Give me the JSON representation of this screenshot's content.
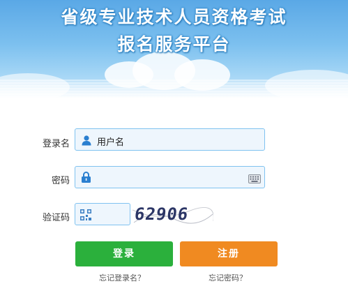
{
  "header": {
    "title_line1": "省级专业技术人员资格考试",
    "title_line2": "报名服务平台"
  },
  "form": {
    "username_label": "登录名",
    "username_value": "用户名",
    "password_label": "密码",
    "password_value": "",
    "captcha_label": "验证码",
    "captcha_value": "",
    "captcha_image_text": "62906"
  },
  "buttons": {
    "login_label": "登录",
    "register_label": "注册"
  },
  "links": {
    "forgot_username": "忘记登录名？",
    "forgot_password": "忘记密码？"
  },
  "colors": {
    "login_button": "#2bb03c",
    "register_button": "#f08a21",
    "field_border": "#7fc2f0",
    "field_bg": "#eef6fd"
  }
}
